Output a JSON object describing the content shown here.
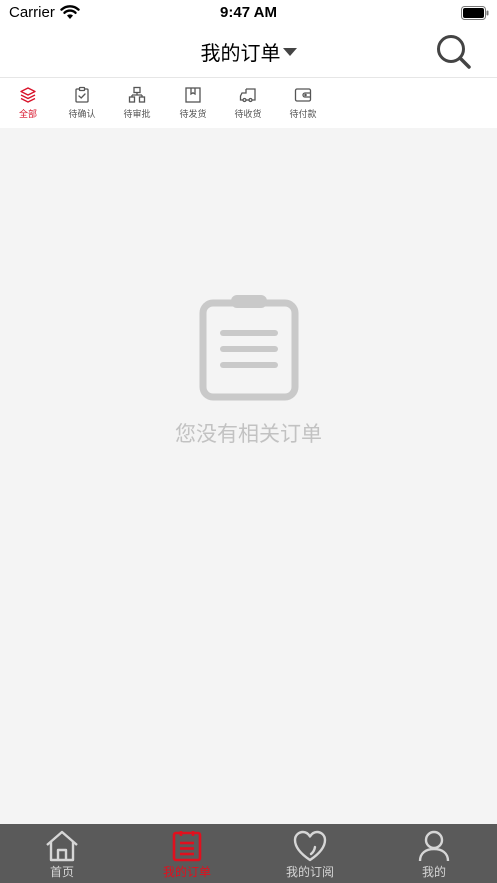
{
  "status_bar": {
    "carrier": "Carrier",
    "time": "9:47 AM"
  },
  "nav": {
    "title": "我的订单"
  },
  "tabs": [
    {
      "label": "全部",
      "icon": "layers-icon",
      "active": true
    },
    {
      "label": "待确认",
      "icon": "clipboard-check-icon"
    },
    {
      "label": "待审批",
      "icon": "hierarchy-icon"
    },
    {
      "label": "待发货",
      "icon": "box-icon"
    },
    {
      "label": "待收货",
      "icon": "truck-icon"
    },
    {
      "label": "待付款",
      "icon": "wallet-icon"
    }
  ],
  "empty_state": {
    "icon": "clipboard-icon",
    "text": "您没有相关订单"
  },
  "tabbar": [
    {
      "label": "首页",
      "icon": "home-icon"
    },
    {
      "label": "我的订单",
      "icon": "order-list-icon",
      "active": true
    },
    {
      "label": "我的订阅",
      "icon": "heart-icon"
    },
    {
      "label": "我的",
      "icon": "user-icon"
    }
  ],
  "colors": {
    "accent": "#d8132a",
    "tabbar_bg": "#5a5a5a",
    "empty_text": "#c2c2c2"
  }
}
